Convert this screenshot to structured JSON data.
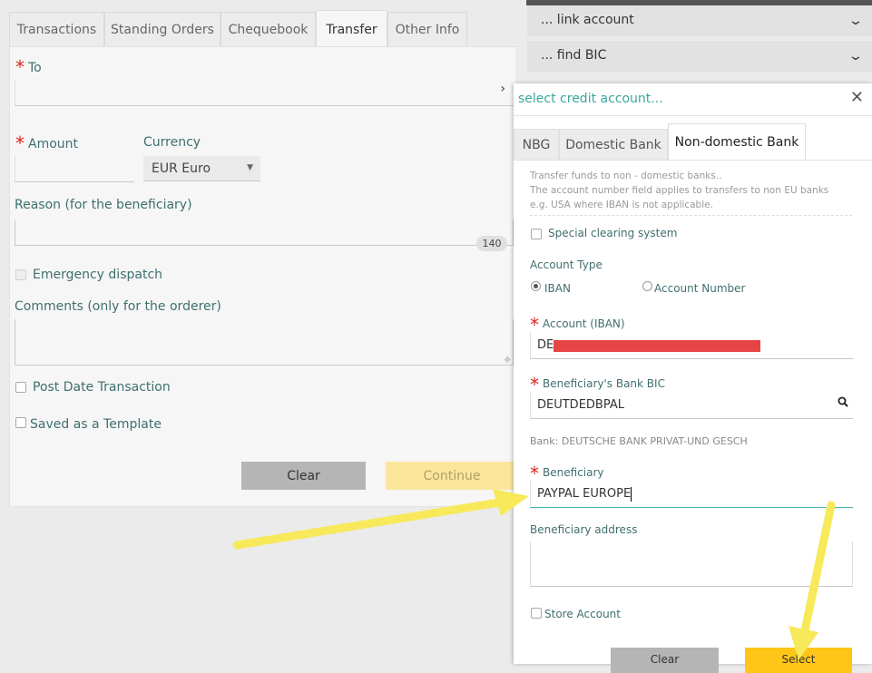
{
  "tabs": [
    "Transactions",
    "Standing Orders",
    "Chequebook",
    "Transfer",
    "Other Info"
  ],
  "form": {
    "to_label": "To",
    "amount_label": "Amount",
    "currency_label": "Currency",
    "currency_value": "EUR Euro",
    "reason_label": "Reason (for the beneficiary)",
    "reason_counter": "140",
    "emergency_label": "Emergency dispatch",
    "comments_label": "Comments (only for the orderer)",
    "post_date_label": "Post Date Transaction",
    "template_label": "Saved as a Template",
    "clear_button": "Clear",
    "continue_button": "Continue"
  },
  "accordion": [
    "... link account",
    "... find BIC"
  ],
  "dialog": {
    "title": "select credit account...",
    "tabs": [
      "NBG",
      "Domestic Bank",
      "Non-domestic Bank"
    ],
    "info_lines": [
      "Transfer funds to non - domestic banks..",
      "The account number field applies to transfers to non EU banks",
      "e.g. USA where IBAN is not applicable."
    ],
    "special_clearing_label": "Special clearing system",
    "account_type_label": "Account Type",
    "radio_iban": "IBAN",
    "radio_account_number": "Account Number",
    "account_iban_label": "Account (IBAN)",
    "account_iban_prefix": "DE",
    "bic_label": "Beneficiary's Bank BIC",
    "bic_value": "DEUTDEDBPAL",
    "bank_info": "Bank: DEUTSCHE BANK PRIVAT-UND GESCH",
    "beneficiary_label": "Beneficiary",
    "beneficiary_value": "PAYPAL EUROPE",
    "beneficiary_address_label": "Beneficiary address",
    "store_account_label": "Store Account",
    "clear_button": "Clear",
    "select_button": "Select"
  },
  "colors": {
    "accent_teal": "#3aa89c",
    "required_red": "#e0241f",
    "redaction": "#e74545",
    "select_yellow": "#ffc517",
    "arrow_yellow": "#f7e95a"
  }
}
